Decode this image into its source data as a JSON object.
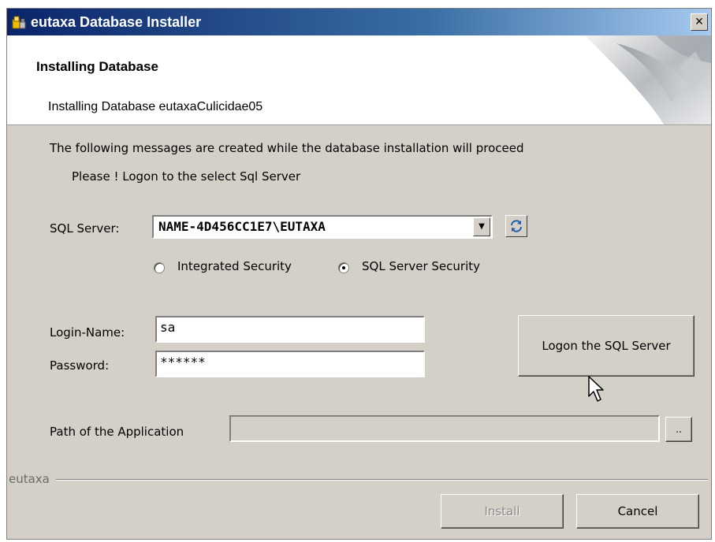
{
  "window": {
    "title": "eutaxa Database Installer",
    "close_label": "×"
  },
  "header": {
    "title": "Installing Database",
    "subtitle": "Installing Database eutaxaCulicidae05"
  },
  "messages": {
    "line1": "The following messages are created while the database installation will proceed",
    "line2": "Please ! Logon to the select Sql Server"
  },
  "server": {
    "label": "SQL Server:",
    "value": "NAME-4D456CC1E7\\EUTAXA"
  },
  "security": {
    "options": [
      "Integrated Security",
      "SQL Server Security"
    ],
    "selected": "SQL Server Security"
  },
  "login": {
    "name_label": "Login-Name:",
    "name_value": "sa",
    "password_label": "Password:",
    "password_value": "******",
    "logon_button": "Logon the SQL Server"
  },
  "path": {
    "label": "Path of the Application",
    "value": "",
    "browse_label": ".."
  },
  "footer": {
    "group_label": "eutaxa",
    "install_label": "Install",
    "cancel_label": "Cancel"
  },
  "icons": [
    "installer-app-icon",
    "close-icon",
    "dropdown-arrow-icon",
    "refresh-icon",
    "mouse-pointer-icon"
  ]
}
